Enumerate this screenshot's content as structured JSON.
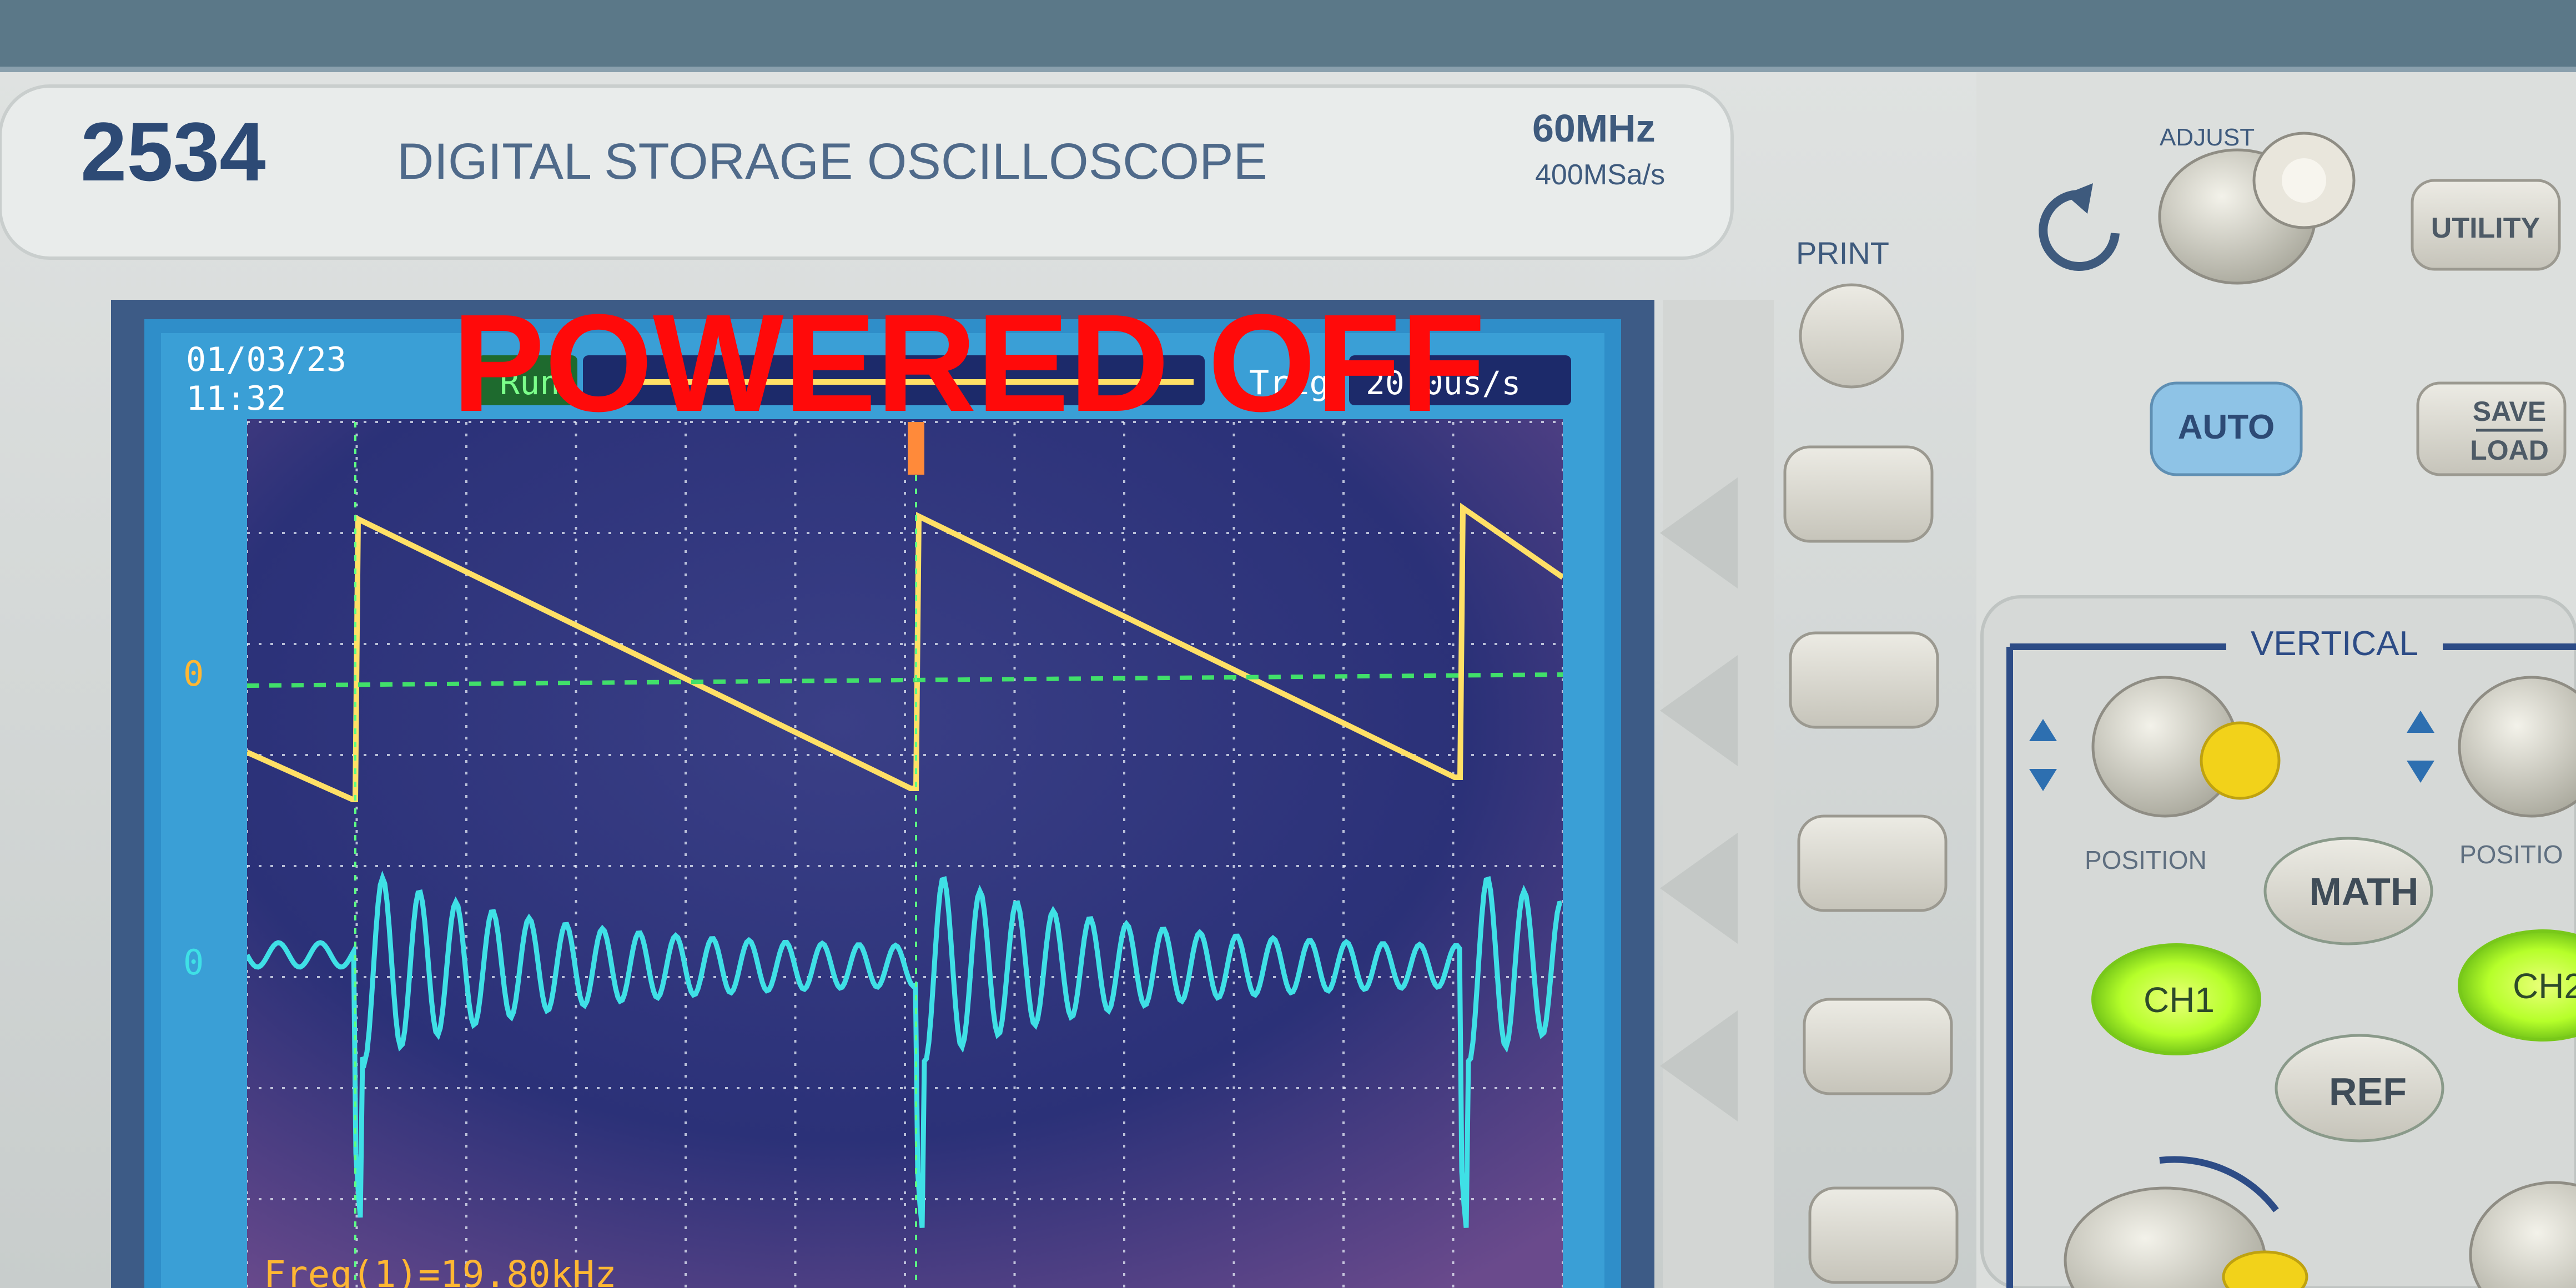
{
  "header": {
    "model": "2534",
    "title": "DIGITAL STORAGE OSCILLOSCOPE",
    "bandwidth": "60MHz",
    "sample_rate": "400MSa/s"
  },
  "overlay": {
    "text": "POWERED OFF",
    "color": "#ff0a0a"
  },
  "screen": {
    "date": "01/03/23",
    "time": "11:32",
    "status_left": "Run",
    "status_right": "Trig",
    "timebase": "20.0us/s",
    "ch1_marker": "0",
    "ch2_marker": "0",
    "readout": "Freq(1)=19.80kHz"
  },
  "buttons": {
    "print": "PRINT",
    "adjust": "ADJUST",
    "utility": "UTILITY",
    "auto": "AUTO",
    "save": "SAVE",
    "load": "LOAD",
    "math": "MATH",
    "ch1": "CH1",
    "ch2": "CH2",
    "ref": "REF"
  },
  "vertical": {
    "title": "VERTICAL",
    "position_label": "POSITION",
    "position_label_right": "POSITIO"
  },
  "colors": {
    "ch1_trace": "#ffe066",
    "ch2_trace": "#3fe0e6",
    "grid": "#e8eef8",
    "screen_bg": "#2b3178",
    "channel_led": "#b6ff2a"
  }
}
